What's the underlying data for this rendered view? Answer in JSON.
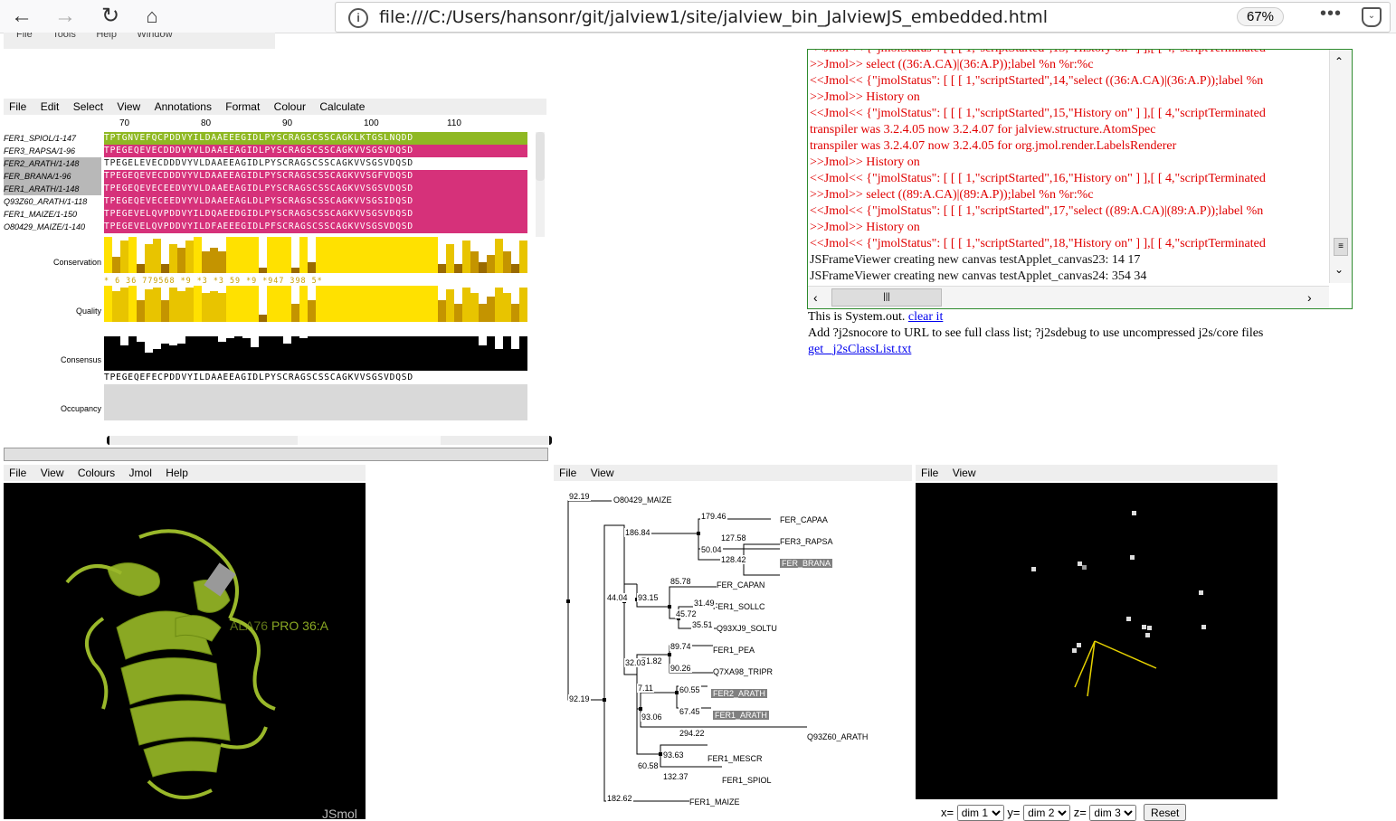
{
  "browser": {
    "url": "file:///C:/Users/hansonr/git/jalview1/site/jalview_bin_JalviewJS_embedded.html",
    "zoom": "67%",
    "back_icon": "arrow-left-icon",
    "forward_icon": "arrow-right-icon",
    "reload_icon": "reload-icon",
    "home_icon": "home-icon"
  },
  "top_strip_menu": [
    "File",
    "Tools",
    "Help",
    "Window"
  ],
  "alignment": {
    "menu": [
      "File",
      "Edit",
      "Select",
      "View",
      "Annotations",
      "Format",
      "Colour",
      "Calculate"
    ],
    "ruler": [
      "70",
      "80",
      "90",
      "100",
      "110"
    ],
    "sequences": [
      {
        "name": "FER1_SPIOL/1-147",
        "seq": "TPTGNVEFQCPDDVYILDAAEEEGIDLPYSCRAGSCSSCAGKLKTGSLNQDD",
        "color": "#8fb823",
        "selected": false
      },
      {
        "name": "FER3_RAPSA/1-96",
        "seq": "TPEGEQEVECDDDVYVLDAAEEAGIDLPYSCRAGSCSSCAGKVVSGSVDQSD",
        "color": "#d6317a",
        "selected": false
      },
      {
        "name": "FER2_ARATH/1-148",
        "seq": "TPEGELEVECDDDVYVLDAAEEAGIDLPYSCRAGSCSSCAGKVVSGSVDQSD",
        "color": "#ffffff",
        "selected": true
      },
      {
        "name": "FER_BRANA/1-96",
        "seq": "TPEGEQEVECDDDVYVLDAAEEAGIDLPYSCRAGSCSSCAGKVVSGFVDQSD",
        "color": "#d6317a",
        "selected": true
      },
      {
        "name": "FER1_ARATH/1-148",
        "seq": "TPEGEQEVECEEDVYVLDAAEEAGIDLPYSCRAGSCSSCAGKVVSGSVDQSD",
        "color": "#d6317a",
        "selected": true
      },
      {
        "name": "Q93Z60_ARATH/1-118",
        "seq": "TPEGEQEVECEEDVYVLDAAEEAGLDLPYSCRAGSCSSCAGKVVSGSIDQSD",
        "color": "#d6317a",
        "selected": false
      },
      {
        "name": "FER1_MAIZE/1-150",
        "seq": "TPEGEVELQVPDDVYILDQAEEDGIDLPYSCRAGSCSSCAGKVVSGSVDQSD",
        "color": "#d6317a",
        "selected": false
      },
      {
        "name": "O80429_MAIZE/1-140",
        "seq": "TPEGEVELQVPDDVYILDFAEEEGIDLPFSCRAGSCSSCAGKVVSGSVDQSD",
        "color": "#d6317a",
        "selected": false
      }
    ],
    "annotations": {
      "conservation_label": "Conservation",
      "quality_label": "Quality",
      "consensus_label": "Consensus",
      "occupancy_label": "Occupancy",
      "conservation_values": "* 6 36 779568 *9 *3 *3 59 *9 *947 398 5*",
      "consensus_seq": "TPEGEQEFECPDDVYILDAAEEAGIDLPYSCRAGSCSSCAGKVVSGSVDQSD",
      "conservation_heights": [
        1,
        0.45,
        0.9,
        1,
        0.25,
        0.8,
        0.95,
        0.25,
        0.8,
        0.7,
        0.9,
        1,
        0.6,
        0.7,
        0.6,
        1,
        1,
        1,
        1,
        0.15,
        1,
        1,
        1,
        0.15,
        1,
        0.3,
        1,
        1,
        1,
        1,
        1,
        1,
        1,
        1,
        1,
        1,
        1,
        1,
        1,
        1,
        1,
        0.25,
        0.8,
        0.25,
        0.9,
        0.6,
        0.3,
        0.5,
        0.95,
        0.6,
        0.25,
        0.9
      ],
      "quality_heights": [
        1,
        0.85,
        0.95,
        1,
        0.6,
        0.9,
        0.95,
        0.6,
        0.95,
        0.85,
        0.95,
        1,
        0.8,
        0.85,
        0.8,
        1,
        1,
        1,
        1,
        0.2,
        1,
        1,
        1,
        0.5,
        1,
        0.6,
        1,
        1,
        1,
        1,
        1,
        1,
        1,
        1,
        1,
        1,
        1,
        1,
        1,
        1,
        1,
        0.6,
        0.9,
        0.5,
        0.95,
        0.8,
        0.5,
        0.7,
        0.95,
        0.8,
        0.5,
        0.95
      ],
      "consensus_heights": [
        0.95,
        0.95,
        0.7,
        0.95,
        0.8,
        0.5,
        0.6,
        0.75,
        0.7,
        0.75,
        0.95,
        0.95,
        0.95,
        0.95,
        0.8,
        0.9,
        0.95,
        0.9,
        0.65,
        0.95,
        0.95,
        0.95,
        0.75,
        0.95,
        0.9,
        0.95,
        0.95,
        0.95,
        0.95,
        0.95,
        0.95,
        0.95,
        0.95,
        0.95,
        0.95,
        0.95,
        0.95,
        0.95,
        0.95,
        0.95,
        0.95,
        0.95,
        0.95,
        0.95,
        0.95,
        0.95,
        0.7,
        0.95,
        0.6,
        0.95,
        0.6,
        0.95
      ]
    }
  },
  "console": {
    "top_partial": "<<Jmol<< {\"jmolStatus\": [ [ [ 1,\"scriptStarted\",13,\"History on\" ] ],[ [ 4,\"scriptTerminated",
    "lines": [
      {
        "text": ">>Jmol>> select ((36:A.CA)|(36:A.P));label %n %r:%c",
        "cls": "red"
      },
      {
        "text": "<<Jmol<< {\"jmolStatus\": [ [ [ 1,\"scriptStarted\",14,\"select ((36:A.CA)|(36:A.P));label %n",
        "cls": "red"
      },
      {
        "text": ">>Jmol>> History on",
        "cls": "red"
      },
      {
        "text": "<<Jmol<< {\"jmolStatus\": [ [ [ 1,\"scriptStarted\",15,\"History on\" ] ],[ [ 4,\"scriptTerminated",
        "cls": "red"
      },
      {
        "text": "transpiler was 3.2.4.05 now 3.2.4.07 for jalview.structure.AtomSpec",
        "cls": "red"
      },
      {
        "text": "transpiler was 3.2.4.07 now 3.2.4.05 for org.jmol.render.LabelsRenderer",
        "cls": "red"
      },
      {
        "text": ">>Jmol>> History on",
        "cls": "red"
      },
      {
        "text": "<<Jmol<< {\"jmolStatus\": [ [ [ 1,\"scriptStarted\",16,\"History on\" ] ],[ [ 4,\"scriptTerminated",
        "cls": "red"
      },
      {
        "text": ">>Jmol>> select ((89:A.CA)|(89:A.P));label %n %r:%c",
        "cls": "red"
      },
      {
        "text": "<<Jmol<< {\"jmolStatus\": [ [ [ 1,\"scriptStarted\",17,\"select ((89:A.CA)|(89:A.P));label %n",
        "cls": "red"
      },
      {
        "text": ">>Jmol>> History on",
        "cls": "red"
      },
      {
        "text": "<<Jmol<< {\"jmolStatus\": [ [ [ 1,\"scriptStarted\",18,\"History on\" ] ],[ [ 4,\"scriptTerminated",
        "cls": "red"
      },
      {
        "text": "JSFrameViewer creating new canvas testApplet_canvas23: 14 17",
        "cls": "blk"
      },
      {
        "text": "JSFrameViewer creating new canvas testApplet_canvas24: 354 34",
        "cls": "blk"
      }
    ],
    "sysout_prefix": "This is System.out.",
    "clear_link": "clear it",
    "hint": "Add ?j2snocore to URL to see full class list; ?j2sdebug to use uncompressed j2s/core files",
    "classlist_link": "get _j2sClassList.txt"
  },
  "jmol": {
    "menu": [
      "File",
      "View",
      "Colours",
      "Jmol",
      "Help"
    ],
    "label": "PRO 36:A",
    "label2": "ALA76",
    "watermark": "JSmol",
    "ribbon_color": "#9ab82a"
  },
  "tree": {
    "menu": [
      "File",
      "View"
    ],
    "leaves": [
      {
        "name": "O80429_MAIZE",
        "sel": false
      },
      {
        "name": "FER_CAPAA",
        "sel": false
      },
      {
        "name": "FER3_RAPSA",
        "sel": false
      },
      {
        "name": "FER_BRANA",
        "sel": true
      },
      {
        "name": "FER_CAPAN",
        "sel": false
      },
      {
        "name": "FER1_SOLLC",
        "sel": false
      },
      {
        "name": "Q93XJ9_SOLTU",
        "sel": false
      },
      {
        "name": "FER1_PEA",
        "sel": false
      },
      {
        "name": "Q7XA98_TRIPR",
        "sel": false
      },
      {
        "name": "FER2_ARATH",
        "sel": true
      },
      {
        "name": "FER1_ARATH",
        "sel": true
      },
      {
        "name": "Q93Z60_ARATH",
        "sel": false
      },
      {
        "name": "FER1_MESCR",
        "sel": false
      },
      {
        "name": "FER1_SPIOL",
        "sel": false
      },
      {
        "name": "FER1_MAIZE",
        "sel": false
      }
    ],
    "distances": [
      "92.19",
      "179.46",
      "186.84",
      "127.58",
      "50.04",
      "128.42",
      "85.78",
      "44.04",
      "93.15",
      "31.49",
      "45.72",
      "35.51",
      "89.74",
      "71.82",
      "32.03",
      "90.26",
      "60.55",
      "7.11",
      "67.45",
      "93.06",
      "294.22",
      "92.19",
      "93.63",
      "60.58",
      "132.37",
      "182.62"
    ]
  },
  "pca": {
    "menu": [
      "File",
      "View"
    ],
    "x_label": "x=",
    "y_label": "y=",
    "z_label": "z=",
    "x_value": "dim 1",
    "y_value": "dim 2",
    "z_value": "dim 3",
    "reset": "Reset"
  }
}
